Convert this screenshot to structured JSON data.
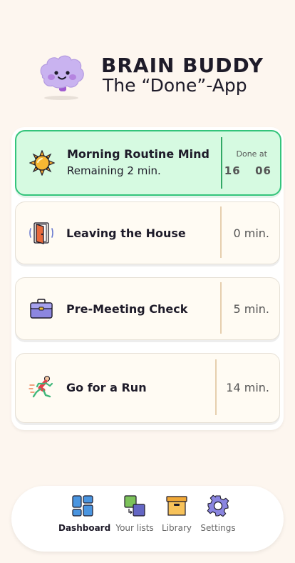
{
  "app": {
    "title": "BRAIN BUDDY",
    "subtitle": "The “Done”-App"
  },
  "routines": [
    {
      "icon": "sun-icon",
      "title": "Morning Routine Mind",
      "remaining": "Remaining 2 min.",
      "done_label": "Done at",
      "done_hour": "16",
      "done_minute": "06",
      "status": "active"
    },
    {
      "icon": "door-exit-icon",
      "title": "Leaving the House",
      "time": "0 min."
    },
    {
      "icon": "briefcase-icon",
      "title": "Pre-Meeting Check",
      "time": "5 min."
    },
    {
      "icon": "runner-icon",
      "title": "Go for a Run",
      "time": "14 min."
    }
  ],
  "nav": {
    "active": "Dashboard",
    "items": [
      {
        "label": "Dashboard",
        "icon": "dashboard-icon"
      },
      {
        "label": "Your lists",
        "icon": "lists-icon"
      },
      {
        "label": "Library",
        "icon": "library-box-icon"
      },
      {
        "label": "Settings",
        "icon": "gear-icon"
      }
    ]
  },
  "colors": {
    "background": "#fdf6ef",
    "active_card": "#d6fae1",
    "active_border": "#33c47b",
    "card": "#fffbf3",
    "mascot": "#c9b3f0"
  }
}
